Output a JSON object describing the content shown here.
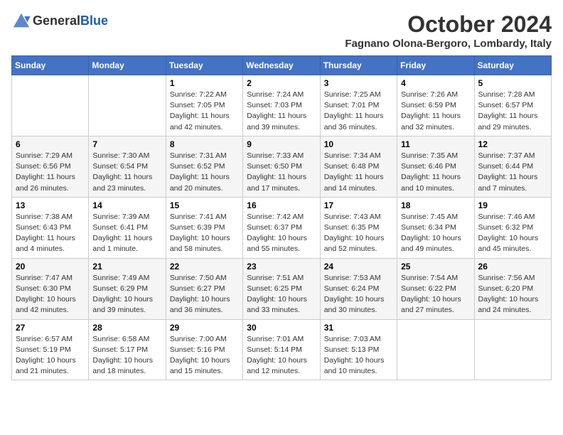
{
  "header": {
    "logo_line1": "General",
    "logo_line2": "Blue",
    "month_year": "October 2024",
    "location": "Fagnano Olona-Bergoro, Lombardy, Italy"
  },
  "days_of_week": [
    "Sunday",
    "Monday",
    "Tuesday",
    "Wednesday",
    "Thursday",
    "Friday",
    "Saturday"
  ],
  "weeks": [
    [
      {
        "day": "",
        "detail": ""
      },
      {
        "day": "",
        "detail": ""
      },
      {
        "day": "1",
        "detail": "Sunrise: 7:22 AM\nSunset: 7:05 PM\nDaylight: 11 hours and 42 minutes."
      },
      {
        "day": "2",
        "detail": "Sunrise: 7:24 AM\nSunset: 7:03 PM\nDaylight: 11 hours and 39 minutes."
      },
      {
        "day": "3",
        "detail": "Sunrise: 7:25 AM\nSunset: 7:01 PM\nDaylight: 11 hours and 36 minutes."
      },
      {
        "day": "4",
        "detail": "Sunrise: 7:26 AM\nSunset: 6:59 PM\nDaylight: 11 hours and 32 minutes."
      },
      {
        "day": "5",
        "detail": "Sunrise: 7:28 AM\nSunset: 6:57 PM\nDaylight: 11 hours and 29 minutes."
      }
    ],
    [
      {
        "day": "6",
        "detail": "Sunrise: 7:29 AM\nSunset: 6:56 PM\nDaylight: 11 hours and 26 minutes."
      },
      {
        "day": "7",
        "detail": "Sunrise: 7:30 AM\nSunset: 6:54 PM\nDaylight: 11 hours and 23 minutes."
      },
      {
        "day": "8",
        "detail": "Sunrise: 7:31 AM\nSunset: 6:52 PM\nDaylight: 11 hours and 20 minutes."
      },
      {
        "day": "9",
        "detail": "Sunrise: 7:33 AM\nSunset: 6:50 PM\nDaylight: 11 hours and 17 minutes."
      },
      {
        "day": "10",
        "detail": "Sunrise: 7:34 AM\nSunset: 6:48 PM\nDaylight: 11 hours and 14 minutes."
      },
      {
        "day": "11",
        "detail": "Sunrise: 7:35 AM\nSunset: 6:46 PM\nDaylight: 11 hours and 10 minutes."
      },
      {
        "day": "12",
        "detail": "Sunrise: 7:37 AM\nSunset: 6:44 PM\nDaylight: 11 hours and 7 minutes."
      }
    ],
    [
      {
        "day": "13",
        "detail": "Sunrise: 7:38 AM\nSunset: 6:43 PM\nDaylight: 11 hours and 4 minutes."
      },
      {
        "day": "14",
        "detail": "Sunrise: 7:39 AM\nSunset: 6:41 PM\nDaylight: 11 hours and 1 minute."
      },
      {
        "day": "15",
        "detail": "Sunrise: 7:41 AM\nSunset: 6:39 PM\nDaylight: 10 hours and 58 minutes."
      },
      {
        "day": "16",
        "detail": "Sunrise: 7:42 AM\nSunset: 6:37 PM\nDaylight: 10 hours and 55 minutes."
      },
      {
        "day": "17",
        "detail": "Sunrise: 7:43 AM\nSunset: 6:35 PM\nDaylight: 10 hours and 52 minutes."
      },
      {
        "day": "18",
        "detail": "Sunrise: 7:45 AM\nSunset: 6:34 PM\nDaylight: 10 hours and 49 minutes."
      },
      {
        "day": "19",
        "detail": "Sunrise: 7:46 AM\nSunset: 6:32 PM\nDaylight: 10 hours and 45 minutes."
      }
    ],
    [
      {
        "day": "20",
        "detail": "Sunrise: 7:47 AM\nSunset: 6:30 PM\nDaylight: 10 hours and 42 minutes."
      },
      {
        "day": "21",
        "detail": "Sunrise: 7:49 AM\nSunset: 6:29 PM\nDaylight: 10 hours and 39 minutes."
      },
      {
        "day": "22",
        "detail": "Sunrise: 7:50 AM\nSunset: 6:27 PM\nDaylight: 10 hours and 36 minutes."
      },
      {
        "day": "23",
        "detail": "Sunrise: 7:51 AM\nSunset: 6:25 PM\nDaylight: 10 hours and 33 minutes."
      },
      {
        "day": "24",
        "detail": "Sunrise: 7:53 AM\nSunset: 6:24 PM\nDaylight: 10 hours and 30 minutes."
      },
      {
        "day": "25",
        "detail": "Sunrise: 7:54 AM\nSunset: 6:22 PM\nDaylight: 10 hours and 27 minutes."
      },
      {
        "day": "26",
        "detail": "Sunrise: 7:56 AM\nSunset: 6:20 PM\nDaylight: 10 hours and 24 minutes."
      }
    ],
    [
      {
        "day": "27",
        "detail": "Sunrise: 6:57 AM\nSunset: 5:19 PM\nDaylight: 10 hours and 21 minutes."
      },
      {
        "day": "28",
        "detail": "Sunrise: 6:58 AM\nSunset: 5:17 PM\nDaylight: 10 hours and 18 minutes."
      },
      {
        "day": "29",
        "detail": "Sunrise: 7:00 AM\nSunset: 5:16 PM\nDaylight: 10 hours and 15 minutes."
      },
      {
        "day": "30",
        "detail": "Sunrise: 7:01 AM\nSunset: 5:14 PM\nDaylight: 10 hours and 12 minutes."
      },
      {
        "day": "31",
        "detail": "Sunrise: 7:03 AM\nSunset: 5:13 PM\nDaylight: 10 hours and 10 minutes."
      },
      {
        "day": "",
        "detail": ""
      },
      {
        "day": "",
        "detail": ""
      }
    ]
  ]
}
